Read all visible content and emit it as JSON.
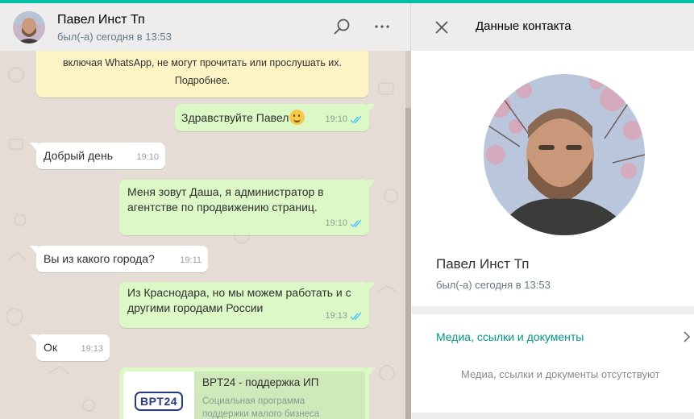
{
  "chat": {
    "contact_name": "Павел Инст Тп",
    "last_seen": "был(-а) сегодня в 13:53",
    "system_notice": {
      "line1": "включая WhatsApp, не могут прочитать или прослушать их.",
      "line2": "Подробнее."
    },
    "messages": [
      {
        "dir": "out",
        "text": "Здравствуйте Павел",
        "time": "19:10",
        "emoji": "smile-emoji"
      },
      {
        "dir": "in",
        "text": "Добрый день",
        "time": "19:10"
      },
      {
        "dir": "out",
        "line1": "Меня зовут Даша, я администратор в",
        "line2": "агентстве по продвижению страниц.",
        "time": "19:10"
      },
      {
        "dir": "in",
        "text": "Вы из какого города?",
        "time": "19:11"
      },
      {
        "dir": "out",
        "line1": "Из Краснодара, но мы можем работать и с",
        "line2": "другими городами России",
        "time": "19:13"
      },
      {
        "dir": "in",
        "text": "Ок",
        "time": "19:13"
      }
    ],
    "link_preview": {
      "logo_text": "BPT24",
      "title": "BPT24 - поддержка ИП",
      "desc_line1": "Социальная программа",
      "desc_line2": "поддержки малого бизнеса"
    },
    "icons": {
      "search": "search-icon",
      "menu": "more-vertical-icon",
      "read": "double-check-icon"
    }
  },
  "contact_panel": {
    "title": "Данные контакта",
    "name": "Павел Инст Тп",
    "last_seen": "был(-а) сегодня в 13:53",
    "media_label": "Медиа, ссылки и документы",
    "media_empty": "Медиа, ссылки и документы отсутствуют",
    "icons": {
      "close": "close-icon",
      "chevron": "chevron-right-icon"
    }
  },
  "colors": {
    "accent": "#00bfa5",
    "outgoing_bubble": "#dcf8c6",
    "incoming_bubble": "#ffffff",
    "chat_background": "#e5ddd5",
    "system_notice": "#fdf4c5",
    "read_ticks": "#4fc3f7",
    "media_link": "#009688"
  }
}
